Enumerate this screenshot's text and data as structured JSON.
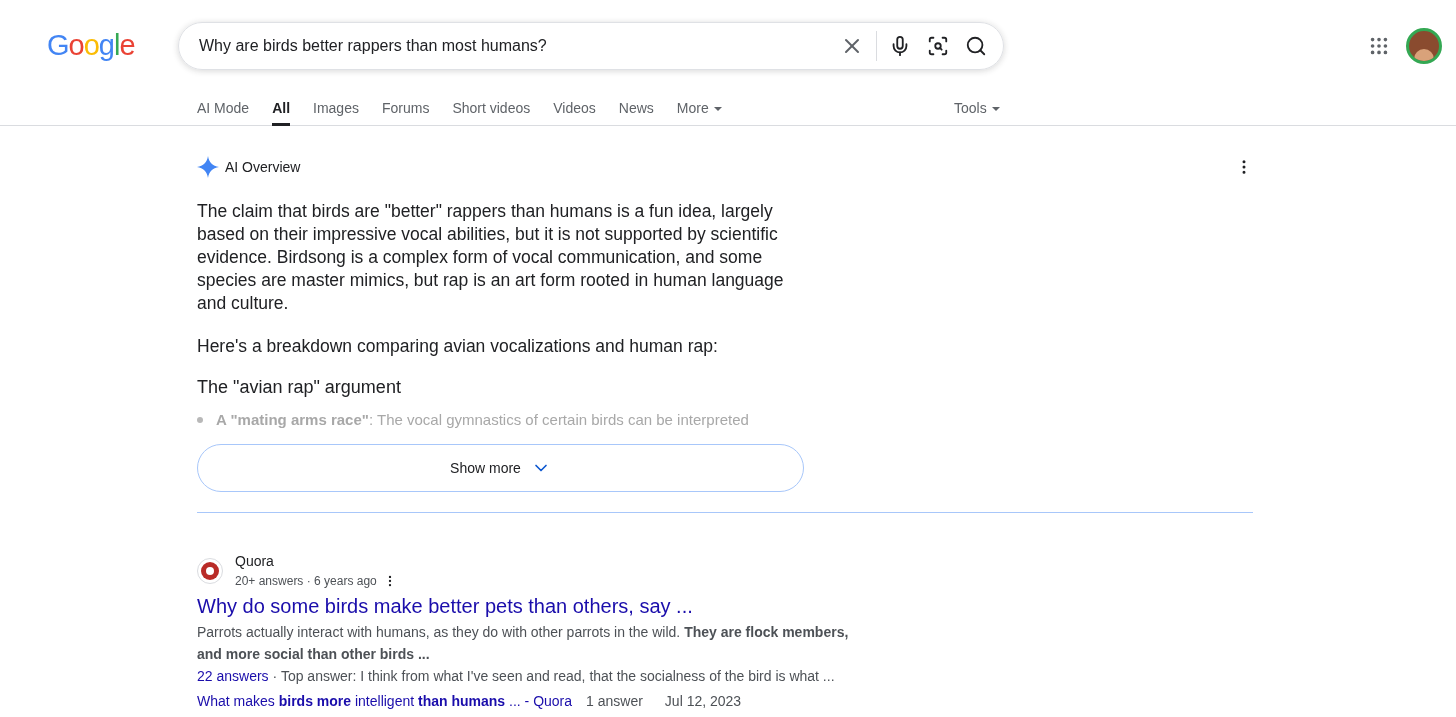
{
  "logo": "Google",
  "search": {
    "value": "Why are birds better rappers than most humans?"
  },
  "tabs": [
    {
      "label": "AI Mode",
      "selected": false
    },
    {
      "label": "All",
      "selected": true
    },
    {
      "label": "Images",
      "selected": false
    },
    {
      "label": "Forums",
      "selected": false
    },
    {
      "label": "Short videos",
      "selected": false
    },
    {
      "label": "Videos",
      "selected": false
    },
    {
      "label": "News",
      "selected": false
    },
    {
      "label": "More",
      "selected": false,
      "kind": "menu"
    }
  ],
  "tools": "Tools",
  "ai_overview": {
    "title": "AI Overview",
    "paragraphs": [
      "The claim that birds are \"better\" rappers than humans is a fun idea, largely based on their impressive vocal abilities, but it is not supported by scientific evidence. Birdsong is a complex form of vocal communication, and some species are master mimics, but rap is an art form rooted in human language and culture.",
      "Here's a breakdown comparing avian vocalizations and human rap:"
    ],
    "heading": "The \"avian rap\" argument",
    "bullet": [
      "**A \"mating arms race\"**: The vocal gymnastics of certain birds can be interpreted"
    ],
    "show_more": "Show more"
  },
  "result": {
    "source": "Quora",
    "meta": "20+ answers · 6 years ago",
    "title": "Why do some birds make better pets than others, say ...",
    "snippet": [
      "Parrots actually interact with humans, as they do with other parrots in the wild. **They are flock members,**",
      "**and more social than other birds ...**"
    ],
    "answers_link": "22 answers",
    "answers_text": "· Top answer: I think from what I've seen and read, that the socialness of the bird is what ...",
    "related": {
      "link": "What makes **birds more** intelligent **than humans** ... - Quora",
      "count": "1 answer",
      "date": "Jul 12, 2023"
    }
  }
}
